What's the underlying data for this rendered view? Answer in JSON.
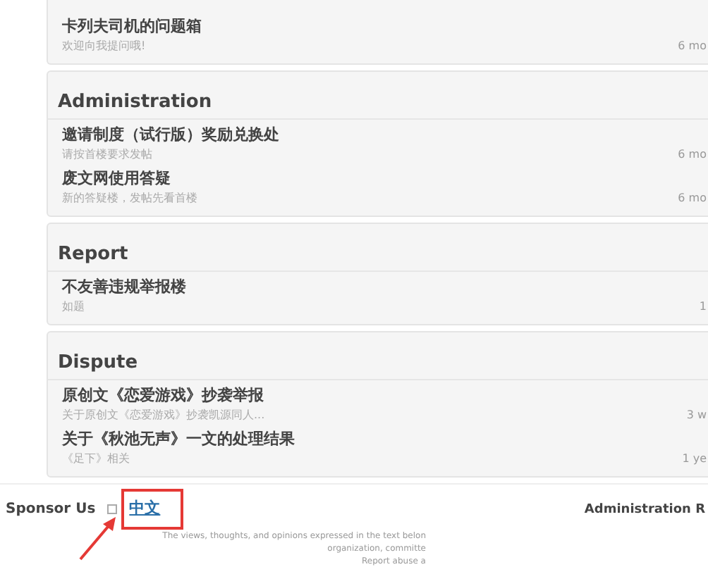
{
  "sections": [
    {
      "topics": [
        {
          "title": "卡列夫司机的问题箱",
          "desc": "欢迎向我提问哦!",
          "time": "6 mo"
        }
      ]
    },
    {
      "title": "Administration",
      "topics": [
        {
          "title": "邀请制度（试行版）奖励兑换处",
          "desc": "请按首楼要求发帖",
          "time": "6 mo"
        },
        {
          "title": "废文网使用答疑",
          "desc": "新的答疑楼，发帖先看首楼",
          "time": "6 mo"
        }
      ]
    },
    {
      "title": "Report",
      "topics": [
        {
          "title": "不友善违规举报楼",
          "desc": "如题",
          "time": "1"
        }
      ]
    },
    {
      "title": "Dispute",
      "topics": [
        {
          "title": "原创文《恋爱游戏》抄袭举报",
          "desc": "关于原创文《恋爱游戏》抄袭凯源同人...",
          "time": "3 w"
        },
        {
          "title": "关于《秋池无声》一文的处理结果",
          "desc": "《足下》相关",
          "time": "1 ye"
        }
      ]
    }
  ],
  "footer": {
    "sponsor": "Sponsor Us",
    "language": "中文",
    "language_highlighted": true,
    "admin": "Administration R",
    "notes": [
      "The views, thoughts, and opinions expressed in the text belon",
      "organization, committe",
      "Report abuse a"
    ]
  }
}
